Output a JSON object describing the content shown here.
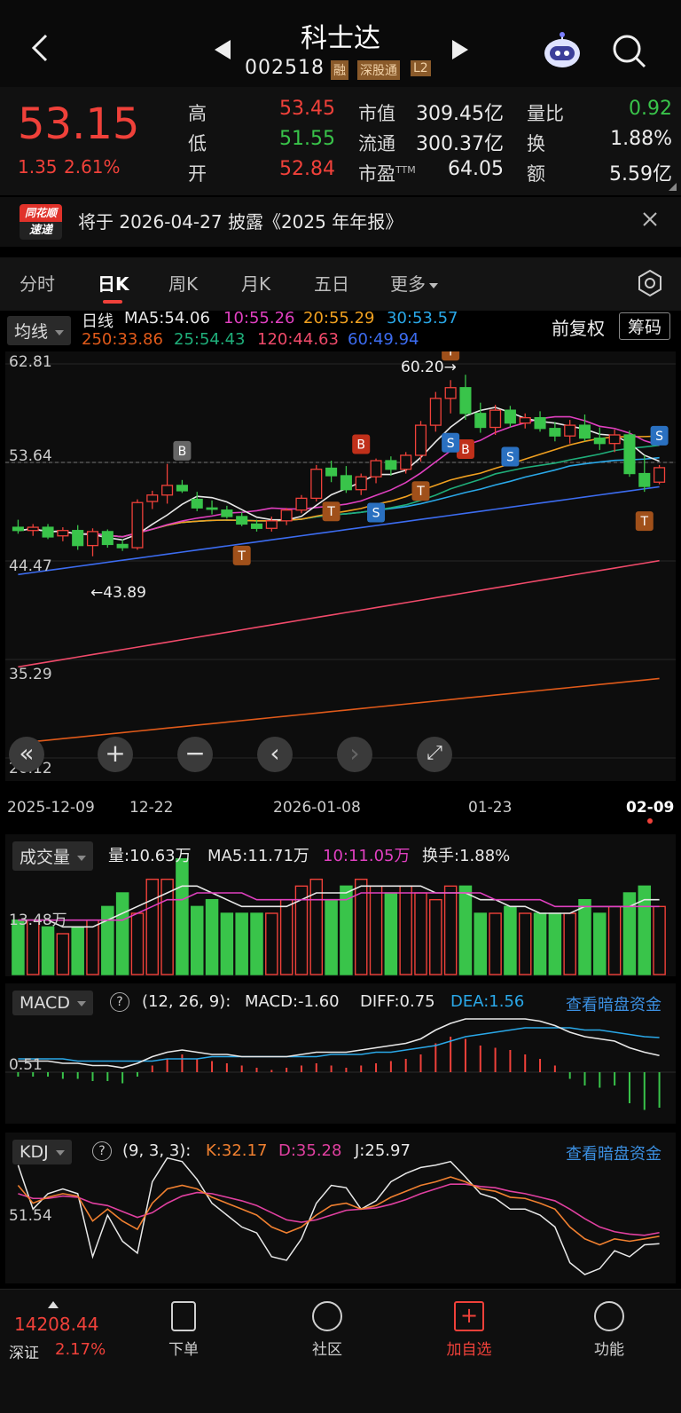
{
  "header": {
    "title": "科士达",
    "code": "002518",
    "badges": [
      "融",
      "深股通",
      "L2"
    ]
  },
  "quote": {
    "price": "53.15",
    "change": "1.35",
    "change_pct": "2.61%",
    "stats": [
      {
        "label": "高",
        "value": "53.45"
      },
      {
        "label": "低",
        "value": "51.55"
      },
      {
        "label": "开",
        "value": "52.84"
      },
      {
        "label": "市值",
        "value": "309.45亿"
      },
      {
        "label": "流通",
        "value": "300.37亿"
      },
      {
        "label": "市盈",
        "label_sup": "TTM",
        "value": "64.05"
      },
      {
        "label": "量比",
        "value": "0.92"
      },
      {
        "label": "换",
        "value": "1.88%"
      },
      {
        "label": "额",
        "value": "5.59亿"
      }
    ]
  },
  "notice": {
    "brand_top": "同花顺",
    "brand_bottom": "速递",
    "text": "将于 2026-04-27 披露《2025 年年报》"
  },
  "tabs": [
    "分时",
    "日K",
    "周K",
    "月K",
    "五日",
    "更多"
  ],
  "ma": {
    "dropdown": "均线",
    "period": "日线",
    "fq": "前复权",
    "chips": "筹码",
    "items": [
      {
        "text": "MA5:54.06",
        "color": "#e8e8e8"
      },
      {
        "text": "10:55.26",
        "color": "#e040c0"
      },
      {
        "text": "20:55.29",
        "color": "#f0a020"
      },
      {
        "text": "30:53.57",
        "color": "#2aa8e8"
      },
      {
        "text": "250:33.86",
        "color": "#e05a1a"
      },
      {
        "text": "25:54.43",
        "color": "#1fae7a"
      },
      {
        "text": "120:44.63",
        "color": "#f04a6a"
      },
      {
        "text": "60:49.94",
        "color": "#3c6cf0"
      }
    ]
  },
  "chart_data": [
    {
      "type": "candlestick",
      "ylim": [
        26.12,
        62.81
      ],
      "y_ticks": [
        "62.81",
        "53.64",
        "44.47",
        "35.29",
        "26.12"
      ],
      "x_ticks": [
        "2025-12-09",
        "12-22",
        "2026-01-08",
        "01-23",
        "02-09"
      ],
      "annotations": [
        "60.20",
        "43.89"
      ],
      "signals": [
        "B",
        "B",
        "B",
        "T",
        "T",
        "T",
        "T",
        "T",
        "S",
        "S",
        "S",
        "S"
      ],
      "ohlc": [
        [
          47.6,
          48.3,
          47.0,
          47.3
        ],
        [
          47.3,
          47.9,
          46.8,
          47.6
        ],
        [
          47.6,
          47.9,
          46.5,
          46.7
        ],
        [
          46.8,
          47.6,
          46.3,
          47.3
        ],
        [
          47.3,
          47.8,
          45.5,
          45.9
        ],
        [
          45.9,
          47.5,
          44.9,
          47.2
        ],
        [
          47.2,
          47.4,
          45.7,
          46.0
        ],
        [
          46.0,
          46.5,
          45.4,
          45.7
        ],
        [
          45.7,
          50.2,
          45.5,
          49.9
        ],
        [
          50.0,
          51.0,
          49.3,
          50.6
        ],
        [
          50.6,
          53.5,
          49.8,
          51.5
        ],
        [
          51.5,
          52.0,
          50.8,
          51.0
        ],
        [
          50.2,
          50.9,
          49.1,
          49.4
        ],
        [
          49.4,
          50.1,
          48.8,
          49.3
        ],
        [
          49.2,
          49.6,
          48.4,
          48.6
        ],
        [
          48.6,
          49.0,
          47.7,
          47.9
        ],
        [
          47.9,
          48.3,
          47.2,
          47.5
        ],
        [
          47.5,
          48.6,
          47.2,
          48.2
        ],
        [
          48.2,
          49.4,
          47.8,
          49.2
        ],
        [
          49.2,
          50.6,
          48.9,
          50.3
        ],
        [
          50.3,
          53.4,
          50.0,
          53.0
        ],
        [
          53.1,
          53.8,
          51.8,
          52.4
        ],
        [
          52.4,
          53.3,
          50.8,
          51.1
        ],
        [
          51.1,
          52.6,
          50.6,
          52.3
        ],
        [
          52.3,
          54.0,
          51.7,
          53.8
        ],
        [
          53.8,
          54.2,
          52.4,
          53.0
        ],
        [
          53.0,
          54.6,
          52.6,
          54.3
        ],
        [
          54.3,
          57.5,
          53.7,
          57.1
        ],
        [
          57.1,
          60.2,
          56.5,
          59.6
        ],
        [
          59.6,
          61.3,
          58.2,
          60.6
        ],
        [
          60.6,
          61.8,
          57.6,
          58.2
        ],
        [
          58.2,
          59.2,
          56.4,
          56.9
        ],
        [
          56.9,
          59.0,
          56.2,
          58.5
        ],
        [
          58.5,
          58.9,
          56.9,
          57.3
        ],
        [
          57.3,
          58.2,
          56.8,
          57.8
        ],
        [
          57.8,
          58.4,
          56.5,
          56.8
        ],
        [
          56.8,
          57.4,
          55.6,
          56.1
        ],
        [
          56.1,
          57.6,
          55.4,
          57.1
        ],
        [
          57.1,
          58.1,
          55.6,
          55.9
        ],
        [
          55.9,
          56.9,
          54.8,
          55.4
        ],
        [
          55.4,
          56.7,
          54.6,
          56.2
        ],
        [
          56.2,
          56.6,
          52.3,
          52.6
        ],
        [
          52.6,
          54.3,
          50.9,
          51.4
        ],
        [
          51.8,
          53.4,
          51.6,
          53.15
        ]
      ]
    },
    {
      "type": "bar",
      "name": "成交量",
      "label": "13.48万",
      "values": [
        8,
        8,
        7,
        6,
        7,
        8,
        10,
        12,
        9,
        14,
        14,
        17,
        10,
        11,
        9,
        9,
        9,
        9,
        11,
        13,
        14,
        11,
        13,
        14,
        13,
        12,
        13,
        12,
        11,
        13,
        13,
        9,
        9,
        10,
        9,
        9,
        9,
        9,
        11,
        9,
        10,
        12,
        13,
        10
      ],
      "ma5": [
        8,
        8,
        8,
        7,
        7,
        7,
        8,
        9,
        10,
        11,
        12,
        13,
        13,
        12,
        11,
        10,
        10,
        10,
        10,
        11,
        12,
        12,
        12,
        13,
        13,
        13,
        13,
        13,
        12,
        12,
        12,
        11,
        11,
        10,
        10,
        9,
        9,
        9,
        10,
        10,
        10,
        10,
        11,
        11
      ],
      "ma10": [
        8,
        8,
        8,
        8,
        8,
        8,
        8,
        8,
        9,
        10,
        11,
        11,
        12,
        12,
        12,
        12,
        11,
        11,
        11,
        11,
        11,
        11,
        11,
        12,
        12,
        12,
        12,
        12,
        12,
        12,
        12,
        12,
        11,
        11,
        11,
        11,
        10,
        10,
        10,
        10,
        10,
        10,
        10,
        10
      ]
    },
    {
      "type": "macd",
      "label": "0.51",
      "hist": [
        -0.2,
        -0.2,
        -0.2,
        -0.3,
        -0.3,
        -0.4,
        -0.4,
        -0.5,
        -0.2,
        0.3,
        0.6,
        0.8,
        0.6,
        0.5,
        0.4,
        0.3,
        0.2,
        0.1,
        0.2,
        0.3,
        0.4,
        0.3,
        0.2,
        0.3,
        0.4,
        0.5,
        0.6,
        0.8,
        1.3,
        1.6,
        1.5,
        1.2,
        1.1,
        1.0,
        0.8,
        0.6,
        0.3,
        -0.3,
        -0.6,
        -0.7,
        -0.6,
        -1.4,
        -1.7,
        -1.6
      ],
      "diff": [
        0.5,
        0.5,
        0.5,
        0.4,
        0.4,
        0.3,
        0.3,
        0.2,
        0.4,
        0.7,
        0.9,
        1.0,
        0.9,
        0.8,
        0.8,
        0.7,
        0.7,
        0.7,
        0.7,
        0.8,
        0.9,
        0.9,
        0.9,
        1.0,
        1.1,
        1.2,
        1.3,
        1.5,
        1.9,
        2.2,
        2.4,
        2.4,
        2.4,
        2.4,
        2.4,
        2.3,
        2.1,
        1.8,
        1.6,
        1.5,
        1.4,
        1.1,
        0.9,
        0.75
      ],
      "dea": [
        0.6,
        0.6,
        0.6,
        0.6,
        0.5,
        0.5,
        0.5,
        0.5,
        0.5,
        0.5,
        0.6,
        0.6,
        0.6,
        0.7,
        0.7,
        0.7,
        0.7,
        0.7,
        0.7,
        0.7,
        0.7,
        0.8,
        0.8,
        0.8,
        0.9,
        0.9,
        1.0,
        1.1,
        1.2,
        1.4,
        1.6,
        1.7,
        1.8,
        1.9,
        2.0,
        2.0,
        2.0,
        2.0,
        1.9,
        1.9,
        1.8,
        1.7,
        1.6,
        1.56
      ]
    },
    {
      "type": "kdj",
      "label": "51.54",
      "k": [
        75,
        60,
        65,
        68,
        66,
        45,
        55,
        45,
        38,
        60,
        72,
        75,
        72,
        65,
        60,
        55,
        50,
        40,
        35,
        40,
        50,
        58,
        60,
        55,
        58,
        65,
        70,
        75,
        78,
        82,
        78,
        72,
        70,
        65,
        64,
        60,
        55,
        40,
        30,
        25,
        30,
        28,
        30,
        32.17
      ],
      "d": [
        68,
        64,
        64,
        66,
        65,
        60,
        58,
        53,
        48,
        52,
        60,
        66,
        69,
        68,
        65,
        62,
        58,
        52,
        46,
        44,
        46,
        50,
        54,
        55,
        56,
        59,
        63,
        68,
        72,
        76,
        76,
        74,
        73,
        70,
        68,
        65,
        62,
        55,
        47,
        40,
        36,
        34,
        33,
        35.28
      ],
      "j": [
        92,
        55,
        68,
        72,
        68,
        15,
        50,
        28,
        18,
        78,
        98,
        95,
        80,
        60,
        50,
        40,
        35,
        15,
        12,
        30,
        60,
        75,
        73,
        55,
        62,
        78,
        85,
        90,
        92,
        95,
        82,
        68,
        64,
        55,
        55,
        50,
        40,
        10,
        0,
        5,
        20,
        15,
        25,
        25.97
      ]
    }
  ],
  "controls": [
    "«",
    "+",
    "−",
    "‹",
    "›",
    "⤢"
  ],
  "volume": {
    "dropdown": "成交量",
    "items": [
      {
        "text": "量:10.63万",
        "color": "#e8e8e8"
      },
      {
        "text": "MA5:11.71万",
        "color": "#e8e8e8"
      },
      {
        "text": "10:11.05万",
        "color": "#e040c0"
      },
      {
        "text": "换手:1.88%",
        "color": "#e8e8e8"
      }
    ]
  },
  "macd": {
    "dropdown": "MACD",
    "help": "?",
    "params": "(12, 26, 9):",
    "items": [
      {
        "text": "MACD:-1.60",
        "color": "#e8e8e8"
      },
      {
        "text": "DIFF:0.75",
        "color": "#e8e8e8"
      },
      {
        "text": "DEA:1.56",
        "color": "#2aa8e8"
      }
    ],
    "link": "查看暗盘资金"
  },
  "kdj": {
    "dropdown": "KDJ",
    "help": "?",
    "params": "(9, 3, 3):",
    "items": [
      {
        "text": "K:32.17",
        "color": "#f08030"
      },
      {
        "text": "D:35.28",
        "color": "#e040a0"
      },
      {
        "text": "J:25.97",
        "color": "#e8e8e8"
      }
    ],
    "link": "查看暗盘资金"
  },
  "bottom": {
    "index_value": "14208.44",
    "index_name": "深证",
    "index_change": "2.17%",
    "nav": [
      "下单",
      "社区",
      "加自选",
      "功能"
    ]
  },
  "colors": {
    "up": "#f0413a",
    "down": "#39c44a",
    "link": "#3b8fe0"
  }
}
